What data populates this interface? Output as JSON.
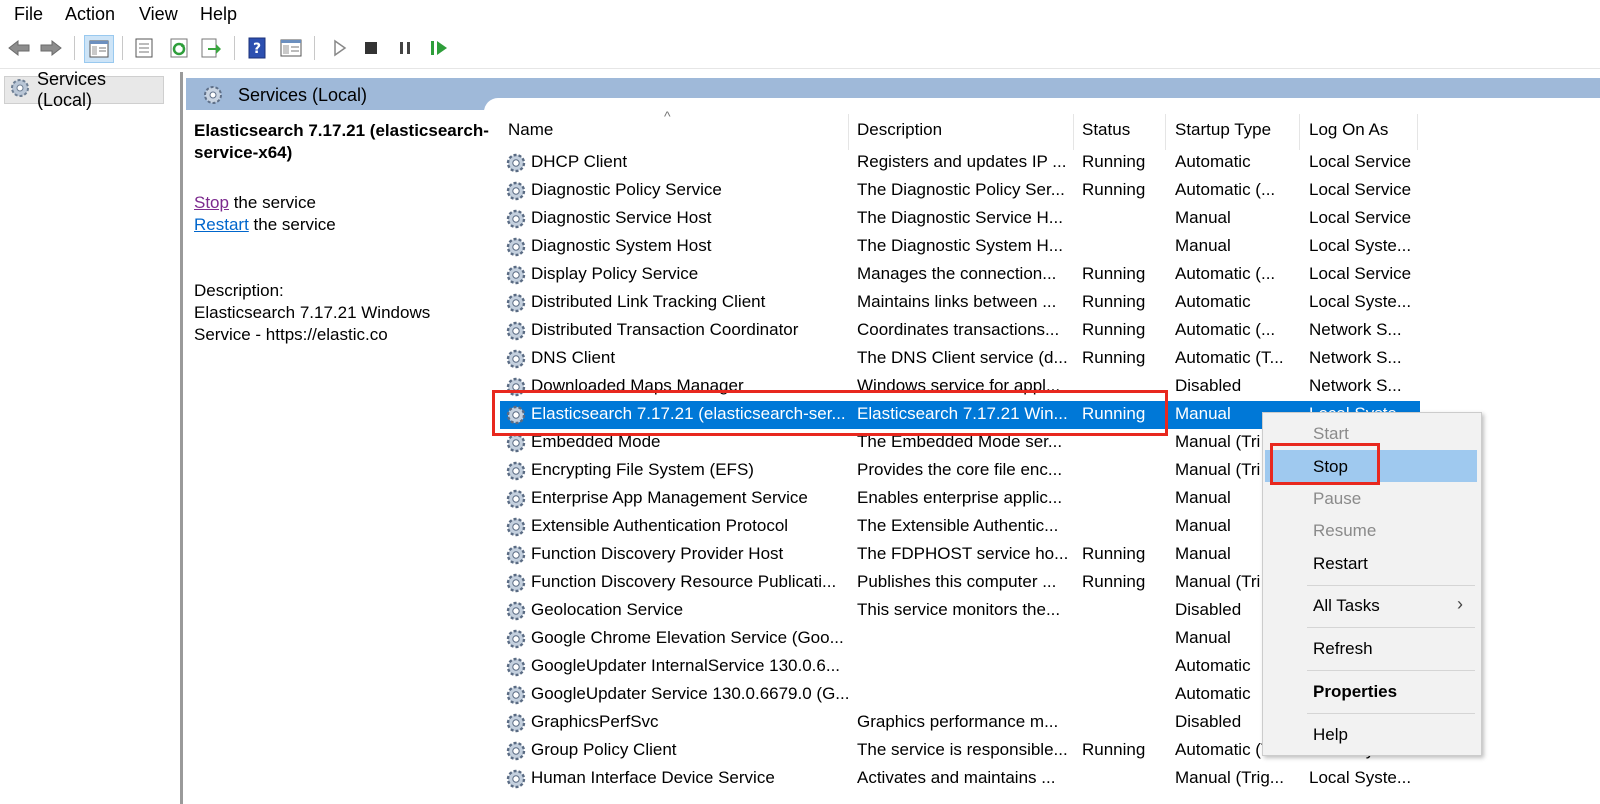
{
  "menu": [
    "File",
    "Action",
    "View",
    "Help"
  ],
  "toolbar_icons": [
    "back-arrow-icon",
    "forward-arrow-icon",
    "show-tree-icon",
    "properties-icon",
    "refresh-icon",
    "export-icon",
    "help-icon",
    "console-icon",
    "start-icon",
    "stop-icon",
    "pause-icon",
    "resume-icon"
  ],
  "tree": {
    "label": "Services (Local)"
  },
  "content_header": {
    "title": "Services (Local)"
  },
  "extended": {
    "service_title": "Elasticsearch 7.17.21 (elasticsearch-service-x64)",
    "stop_link": "Stop",
    "stop_suffix": " the service",
    "restart_link": "Restart",
    "restart_suffix": " the service",
    "description_label": "Description:",
    "description_text": "Elasticsearch 7.17.21 Windows Service - https://elastic.co"
  },
  "columns": {
    "name": "Name",
    "description": "Description",
    "status": "Status",
    "startup": "Startup Type",
    "logon": "Log On As"
  },
  "rows": [
    {
      "name": "DHCP Client",
      "description": "Registers and updates IP ...",
      "status": "Running",
      "startup": "Automatic",
      "logon": "Local Service"
    },
    {
      "name": "Diagnostic Policy Service",
      "description": "The Diagnostic Policy Ser...",
      "status": "Running",
      "startup": "Automatic (...",
      "logon": "Local Service"
    },
    {
      "name": "Diagnostic Service Host",
      "description": "The Diagnostic Service H...",
      "status": "",
      "startup": "Manual",
      "logon": "Local Service"
    },
    {
      "name": "Diagnostic System Host",
      "description": "The Diagnostic System H...",
      "status": "",
      "startup": "Manual",
      "logon": "Local Syste..."
    },
    {
      "name": "Display Policy Service",
      "description": "Manages the connection...",
      "status": "Running",
      "startup": "Automatic (...",
      "logon": "Local Service"
    },
    {
      "name": "Distributed Link Tracking Client",
      "description": "Maintains links between ...",
      "status": "Running",
      "startup": "Automatic",
      "logon": "Local Syste..."
    },
    {
      "name": "Distributed Transaction Coordinator",
      "description": "Coordinates transactions...",
      "status": "Running",
      "startup": "Automatic (...",
      "logon": "Network S..."
    },
    {
      "name": "DNS Client",
      "description": "The DNS Client service (d...",
      "status": "Running",
      "startup": "Automatic (T...",
      "logon": "Network S..."
    },
    {
      "name": "Downloaded Maps Manager",
      "description": "Windows service for appl...",
      "status": "",
      "startup": "Disabled",
      "logon": "Network S..."
    },
    {
      "name": "Elasticsearch 7.17.21 (elasticsearch-ser...",
      "description": "Elasticsearch 7.17.21 Win...",
      "status": "Running",
      "startup": "Manual",
      "logon": "Local Syste...",
      "selected": true
    },
    {
      "name": "Embedded Mode",
      "description": "The Embedded Mode ser...",
      "status": "",
      "startup": "Manual (Tri",
      "logon": ""
    },
    {
      "name": "Encrypting File System (EFS)",
      "description": "Provides the core file enc...",
      "status": "",
      "startup": "Manual (Tri",
      "logon": ""
    },
    {
      "name": "Enterprise App Management Service",
      "description": "Enables enterprise applic...",
      "status": "",
      "startup": "Manual",
      "logon": ""
    },
    {
      "name": "Extensible Authentication Protocol",
      "description": "The Extensible Authentic...",
      "status": "",
      "startup": "Manual",
      "logon": ""
    },
    {
      "name": "Function Discovery Provider Host",
      "description": "The FDPHOST service ho...",
      "status": "Running",
      "startup": "Manual",
      "logon": ""
    },
    {
      "name": "Function Discovery Resource Publicati...",
      "description": "Publishes this computer ...",
      "status": "Running",
      "startup": "Manual (Tri",
      "logon": ""
    },
    {
      "name": "Geolocation Service",
      "description": "This service monitors the...",
      "status": "",
      "startup": "Disabled",
      "logon": ""
    },
    {
      "name": "Google Chrome Elevation Service (Goo...",
      "description": "",
      "status": "",
      "startup": "Manual",
      "logon": ""
    },
    {
      "name": "GoogleUpdater InternalService 130.0.6...",
      "description": "",
      "status": "",
      "startup": "Automatic",
      "logon": ""
    },
    {
      "name": "GoogleUpdater Service 130.0.6679.0 (G...",
      "description": "",
      "status": "",
      "startup": "Automatic",
      "logon": ""
    },
    {
      "name": "GraphicsPerfSvc",
      "description": "Graphics performance m...",
      "status": "",
      "startup": "Disabled",
      "logon": ""
    },
    {
      "name": "Group Policy Client",
      "description": "The service is responsible...",
      "status": "Running",
      "startup": "Automatic (T...",
      "logon": "Local Syste..."
    },
    {
      "name": "Human Interface Device Service",
      "description": "Activates and maintains ...",
      "status": "",
      "startup": "Manual (Trig...",
      "logon": "Local Syste..."
    }
  ],
  "context_menu": {
    "start": "Start",
    "stop": "Stop",
    "pause": "Pause",
    "resume": "Resume",
    "restart": "Restart",
    "all_tasks": "All Tasks",
    "refresh": "Refresh",
    "properties": "Properties",
    "help": "Help"
  },
  "colors": {
    "selection": "#0078d7",
    "header_bar": "#9fb9d9",
    "highlight_box": "#e8281e",
    "menu_hover": "#9fc9ef"
  }
}
